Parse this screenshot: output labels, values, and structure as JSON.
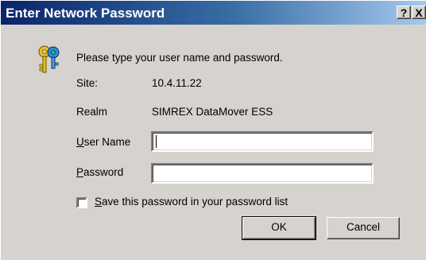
{
  "window": {
    "title": "Enter Network Password",
    "help_glyph": "?",
    "close_glyph": "X"
  },
  "prompt": "Please type your user name and password.",
  "site": {
    "label": "Site:",
    "value": "10.4.11.22"
  },
  "realm": {
    "label": "Realm",
    "value": "SIMREX DataMover ESS"
  },
  "username": {
    "label_accel": "U",
    "label_rest": "ser Name",
    "value": ""
  },
  "password": {
    "label_accel": "P",
    "label_rest": "assword",
    "value": ""
  },
  "save_password": {
    "label_accel": "S",
    "label_rest": "ave this password in your password list",
    "checked": false
  },
  "buttons": {
    "ok": "OK",
    "cancel": "Cancel"
  },
  "icons": {
    "dialog_icon": "keys-icon"
  }
}
